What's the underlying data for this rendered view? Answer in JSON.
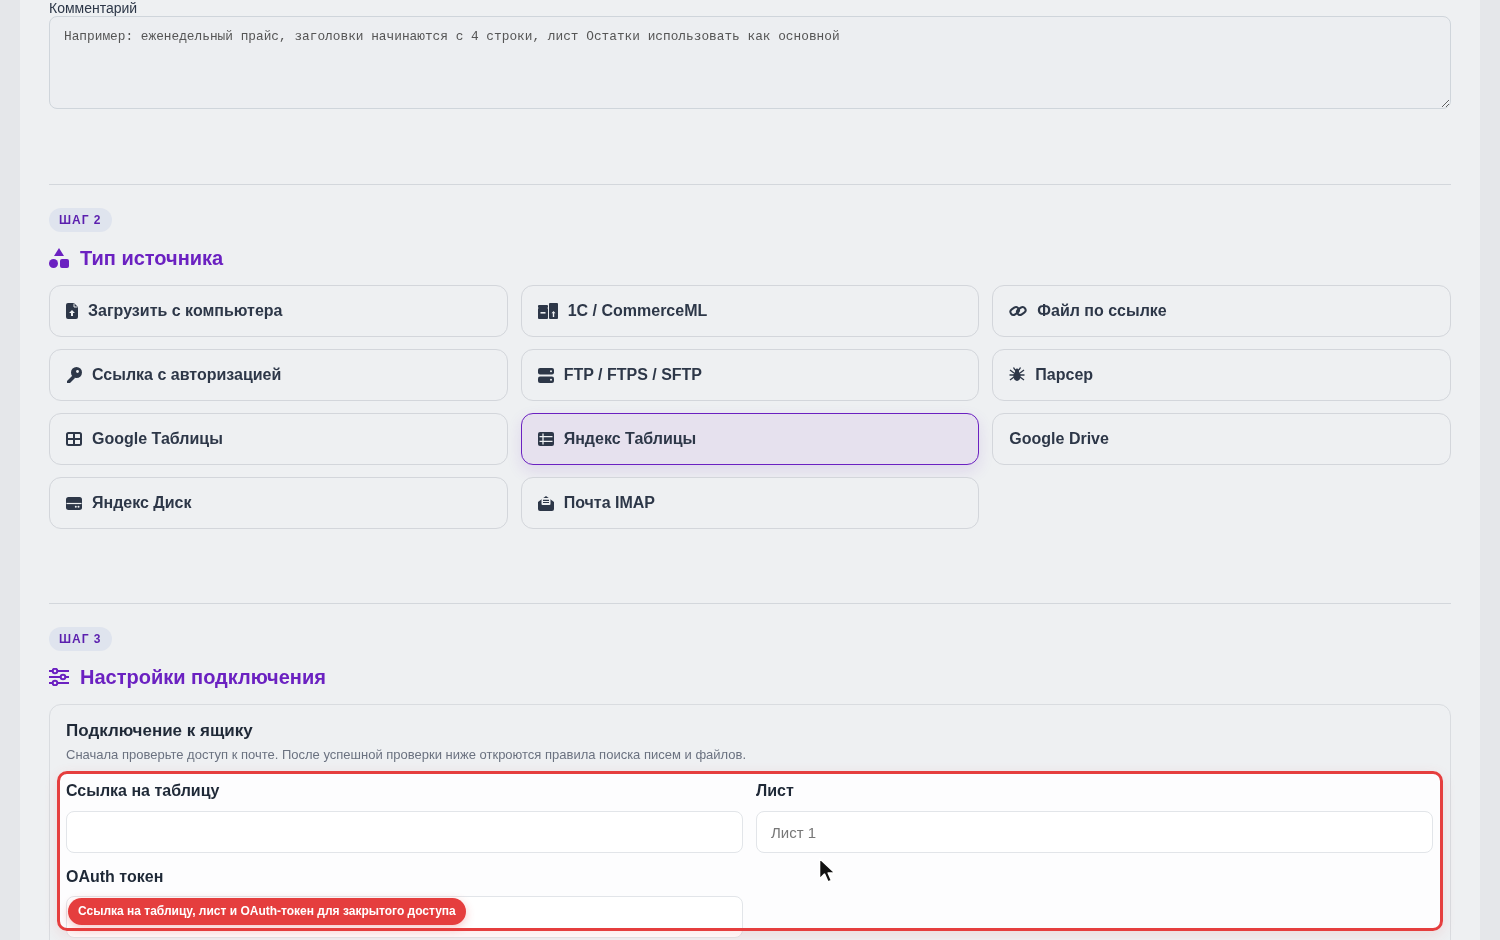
{
  "comment": {
    "label": "Комментарий",
    "placeholder": "Например: еженедельный прайс, заголовки начинаются с 4 строки, лист Остатки использовать как основной"
  },
  "source_step": {
    "badge": "ШАГ 2",
    "title": "Тип источника",
    "options": [
      {
        "label": "Загрузить с компьютера",
        "selected": false
      },
      {
        "label": "1C / CommerceML",
        "selected": false
      },
      {
        "label": "Файл по ссылке",
        "selected": false
      },
      {
        "label": "Ссылка с авторизацией",
        "selected": false
      },
      {
        "label": "FTP / FTPS / SFTP",
        "selected": false
      },
      {
        "label": "Парсер",
        "selected": false
      },
      {
        "label": "Google Таблицы",
        "selected": false
      },
      {
        "label": "Яндекс Таблицы",
        "selected": true
      },
      {
        "label": "Google Drive",
        "selected": false
      },
      {
        "label": "Яндекс Диск",
        "selected": false
      },
      {
        "label": "Почта IMAP",
        "selected": false
      }
    ]
  },
  "connection_step": {
    "badge": "ШАГ 3",
    "title": "Настройки подключения",
    "panel": {
      "title": "Подключение к ящику",
      "description": "Сначала проверьте доступ к почте. После успешной проверки ниже откроются правила поиска писем и файлов.",
      "highlighted": true,
      "fields": [
        {
          "label": "Ссылка на таблицу"
        },
        {
          "label": "Лист",
          "placeholder": "Лист 1"
        },
        {
          "label": "OAuth токен",
          "callout": "Ссылка на таблицу, лист и OAuth-токен для закрытого доступа"
        }
      ]
    }
  }
}
